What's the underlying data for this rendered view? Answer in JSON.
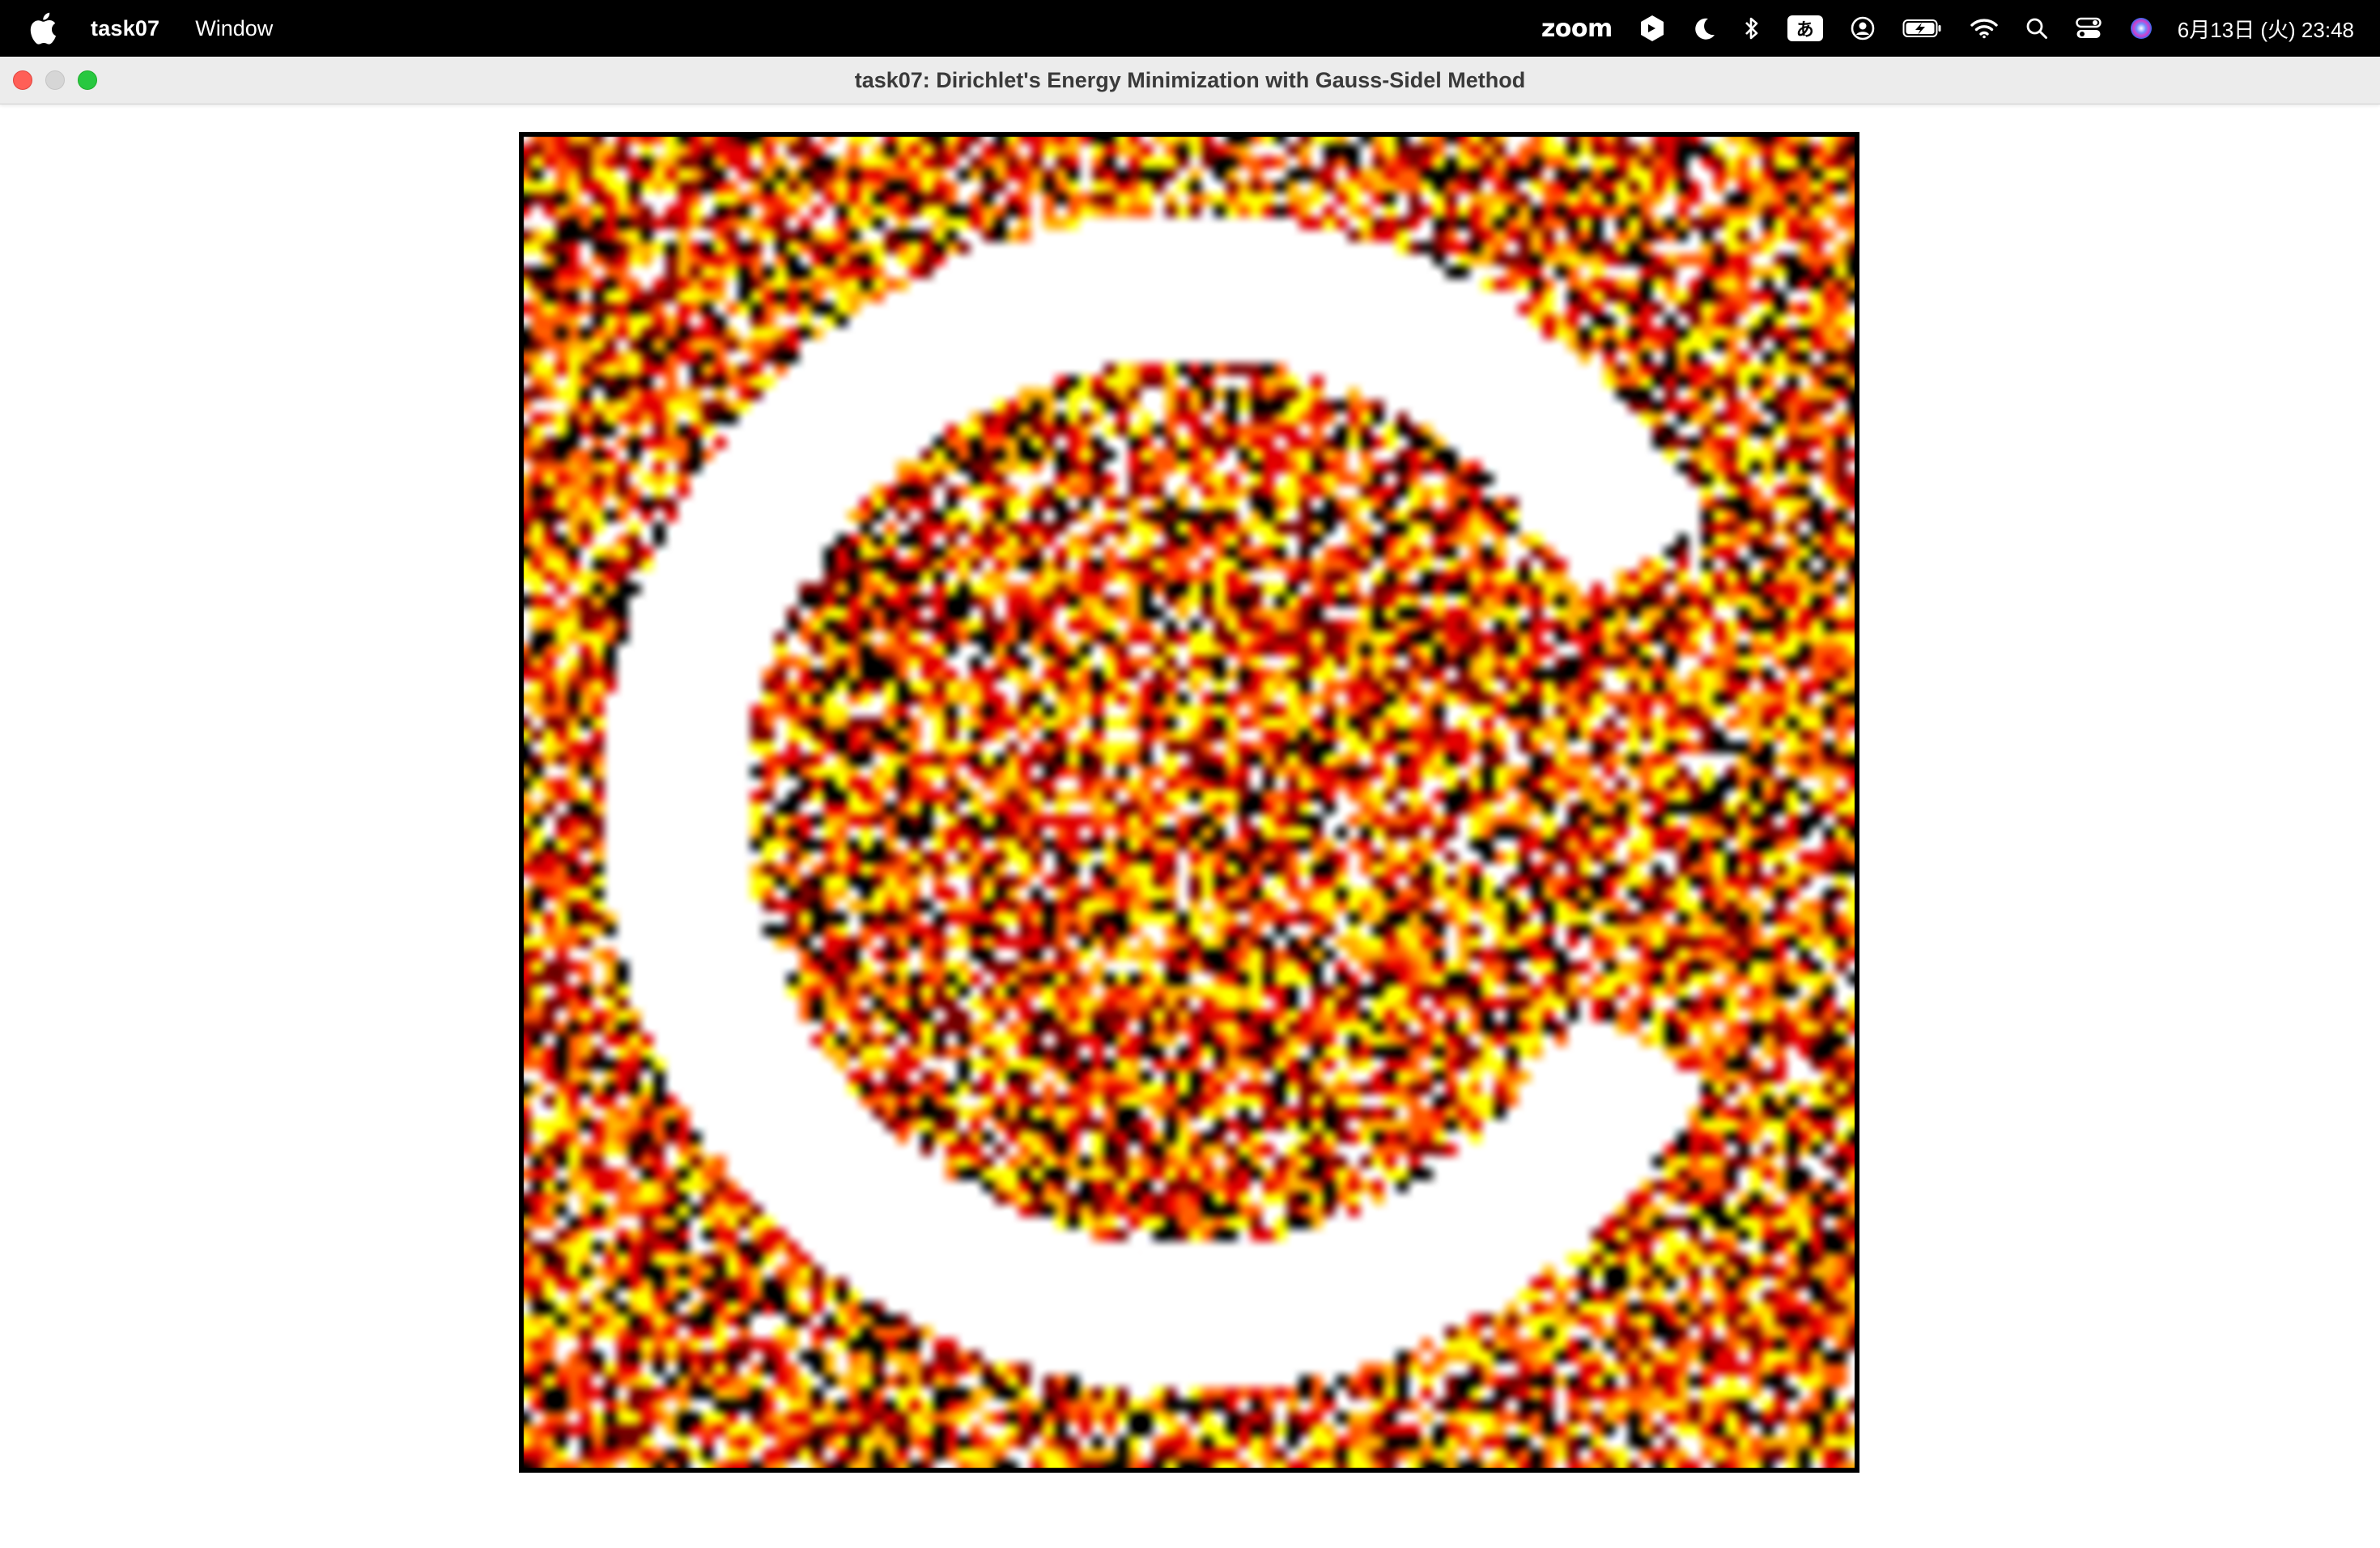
{
  "menubar": {
    "app_name": "task07",
    "menus": [
      "Window"
    ],
    "status_icons": [
      "zoom-text",
      "screen-share-icon",
      "moon-icon",
      "bluetooth-icon",
      "input-method-icon",
      "user-icon",
      "battery-icon",
      "wifi-icon",
      "spotlight-search-icon",
      "control-center-icon",
      "siri-icon"
    ],
    "zoom_label": "zoom",
    "ime_label": "あ",
    "clock": "6月13日 (火)  23:48"
  },
  "window": {
    "title": "task07: Dirichlet's Energy Minimization with Gauss-Sidel Method"
  },
  "render": {
    "grid_resolution": 110,
    "palette": [
      "#000000",
      "#7a0000",
      "#e00000",
      "#ff5a00",
      "#ffb000",
      "#ffff00",
      "#ffffff"
    ],
    "fixed_region_color": "#ffffff"
  }
}
